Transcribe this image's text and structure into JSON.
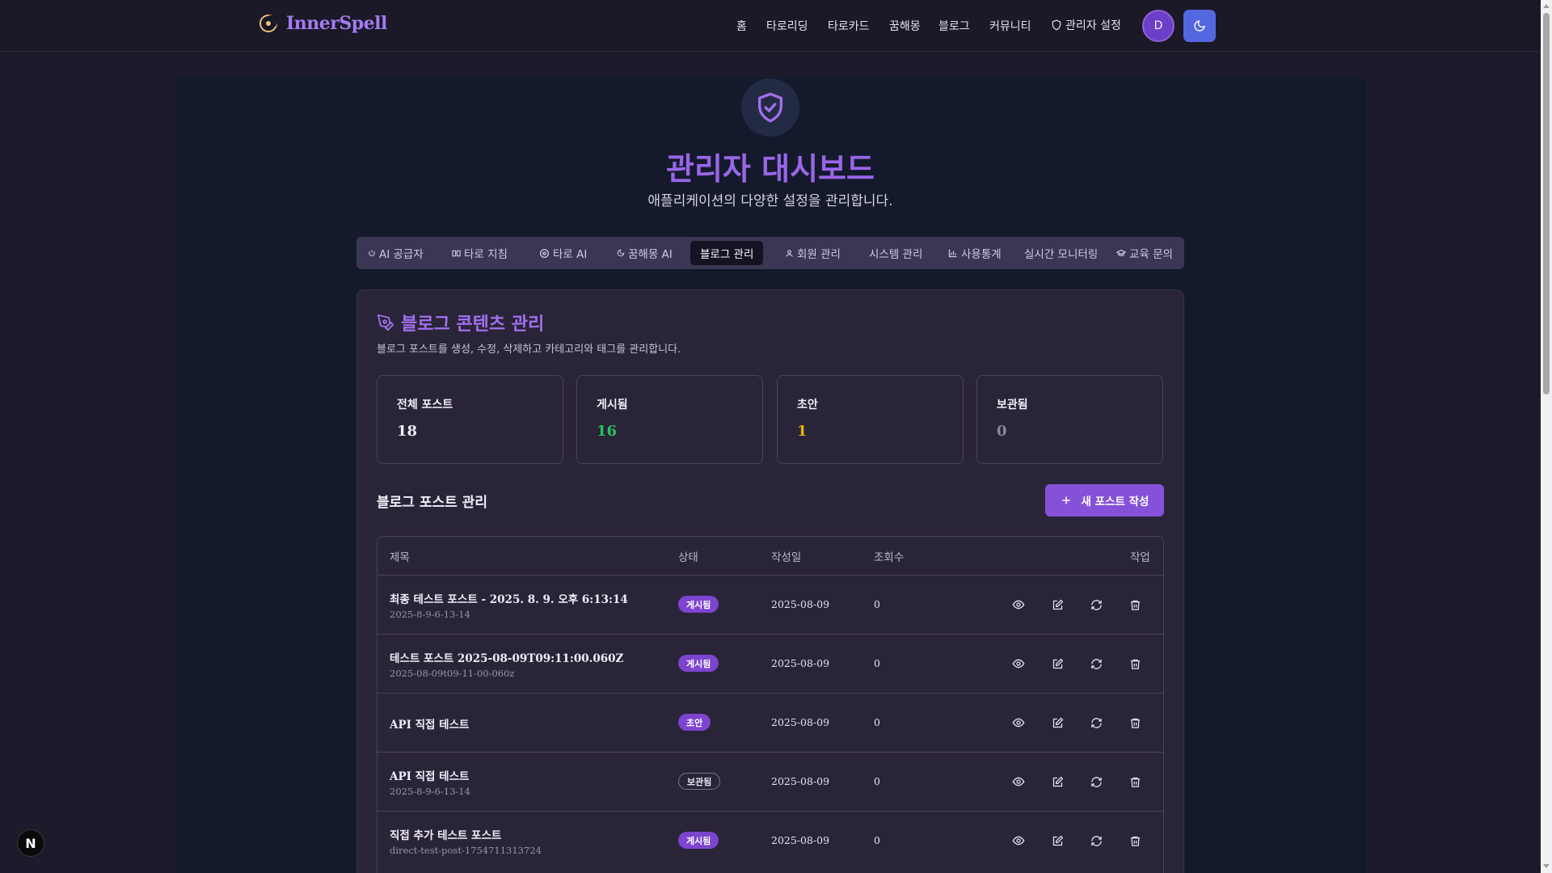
{
  "brand": {
    "name": "InnerSpell",
    "logo_icon": "eye-moon-icon"
  },
  "nav": {
    "items": [
      "홈",
      "타로리딩",
      "타로카드",
      "꿈해몽",
      "블로그",
      "커뮤니티"
    ],
    "admin_label": "관리자 설정",
    "avatar_initial": "D",
    "theme_icon": "moon-icon"
  },
  "hero": {
    "icon": "shield-check-icon",
    "title": "관리자 대시보드",
    "subtitle": "애플리케이션의 다양한 설정을 관리합니다."
  },
  "tabs": [
    {
      "label": "AI 공급자",
      "icon": "power-icon"
    },
    {
      "label": "타로 지침",
      "icon": "book-icon"
    },
    {
      "label": "타로 AI",
      "icon": "settings-icon"
    },
    {
      "label": "꿈해몽 AI",
      "icon": "moon-icon"
    },
    {
      "label": "블로그 관리",
      "icon": "",
      "active": true
    },
    {
      "label": "회원 관리",
      "icon": "users-icon"
    },
    {
      "label": "시스템 관리",
      "icon": ""
    },
    {
      "label": "사용통계",
      "icon": "bar-chart-icon"
    },
    {
      "label": "실시간 모니터링",
      "icon": ""
    },
    {
      "label": "교육 문의",
      "icon": "graduation-cap-icon"
    }
  ],
  "blog": {
    "title": "블로그 콘텐츠 관리",
    "title_icon": "pen-tool-icon",
    "description": "블로그 포스트를 생성, 수정, 삭제하고 카테고리와 태그를 관리합니다.",
    "stats": [
      {
        "label": "전체 포스트",
        "value": "18",
        "color": "#f0edf7"
      },
      {
        "label": "게시됨",
        "value": "16",
        "color": "#22c55e"
      },
      {
        "label": "초안",
        "value": "1",
        "color": "#eab308"
      },
      {
        "label": "보관됨",
        "value": "0",
        "color": "#8b8799"
      }
    ],
    "section_title": "블로그 포스트 관리",
    "new_post_label": "새 포스트 작성",
    "table": {
      "headers": {
        "title": "제목",
        "status": "상태",
        "date": "작성일",
        "views": "조회수",
        "actions": "작업"
      },
      "rows": [
        {
          "title": "최종 테스트 포스트 - 2025. 8. 9. 오후 6:13:14",
          "slug": "2025-8-9-6-13-14",
          "status": "게시됨",
          "date": "2025-08-09",
          "views": "0"
        },
        {
          "title": "테스트 포스트 2025-08-09T09:11:00.060Z",
          "slug": "2025-08-09t09-11-00-060z",
          "status": "게시됨",
          "date": "2025-08-09",
          "views": "0"
        },
        {
          "title": "API 직접 테스트",
          "slug": "",
          "status": "초안",
          "date": "2025-08-09",
          "views": "0"
        },
        {
          "title": "API 직접 테스트",
          "slug": "2025-8-9-6-13-14",
          "status": "보관됨",
          "date": "2025-08-09",
          "views": "0"
        },
        {
          "title": "직접 추가 테스트 포스트",
          "slug": "direct-test-post-1754711313724",
          "status": "게시됨",
          "date": "2025-08-09",
          "views": "0"
        }
      ],
      "action_icons": [
        "eye-icon",
        "edit-icon",
        "refresh-icon",
        "trash-icon"
      ]
    }
  },
  "colors": {
    "accent": "#9a66e8",
    "primary_button": "#8551d8",
    "theme_button": "#5368e0"
  },
  "dev_badge": "N"
}
